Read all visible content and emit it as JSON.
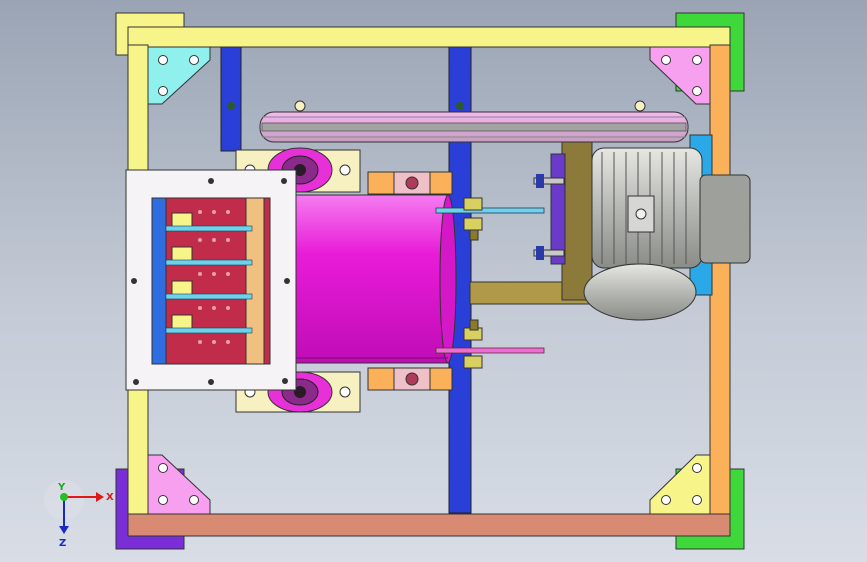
{
  "triad": {
    "x_label": "X",
    "y_label": "Y",
    "z_label": "Z"
  },
  "colors": {
    "frame_yellow": "#f7f58a",
    "frame_orange": "#fbb05a",
    "frame_salmon": "#d98a72",
    "post_blue": "#2a3fd8",
    "post_dark": "#142e8e",
    "corner_purple": "#7a2ed8",
    "corner_green": "#3fd83a",
    "gusset_cyan": "#8ff0ee",
    "gusset_pink": "#f7a0f0",
    "rotor_magenta": "#ea1ee0",
    "hammer_red": "#c02c4a",
    "motor_grey": "#b8bab6"
  }
}
